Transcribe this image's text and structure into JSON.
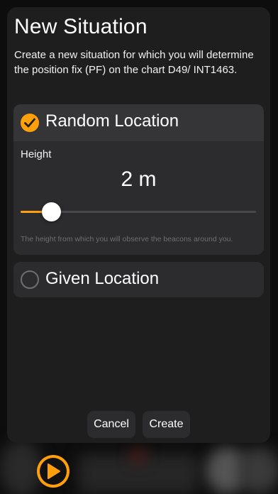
{
  "dialog": {
    "title": "New Situation",
    "description": "Create a new situation for which you will determine the position fix (PF) on the chart D49/ INT1463."
  },
  "options": {
    "random": {
      "label": "Random Location",
      "selected": true,
      "height_label": "Height",
      "height_value": "2 m",
      "slider_fraction": 0.13,
      "hint": "The height from which you will observe the beacons around you."
    },
    "given": {
      "label": "Given Location",
      "selected": false
    }
  },
  "buttons": {
    "cancel": "Cancel",
    "create": "Create"
  },
  "colors": {
    "accent": "#ff9f0a",
    "sheet_bg": "#1e1e1e",
    "card_bg": "#2c2c2e"
  },
  "icons": {
    "check": "checkmark-circle-icon",
    "radio": "radio-empty-icon",
    "play": "play-icon"
  }
}
